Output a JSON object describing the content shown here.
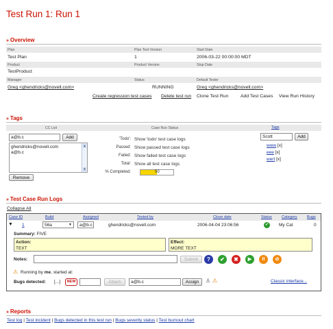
{
  "page_title": "Test Run 1: Run 1",
  "overview": {
    "heading": "Overview",
    "plan_label": "Plan",
    "plan_value": "Test Plan",
    "plan_text_version_label": "Plan Text Version",
    "plan_text_version_value": "1",
    "start_date_label": "Start Date",
    "start_date_value": "2006-03-22 00:00:00 MDT",
    "product_label": "Product",
    "product_value": "TestProduct",
    "product_version_label": "Product Version",
    "stop_date_label": "Stop Date",
    "manager_label": "Manager",
    "manager_value": "Greg <ghendricks@novell.com>",
    "status_label": "Status",
    "status_value": "RUNNING",
    "default_tester_label": "Default Tester",
    "default_tester_value": "Greg <ghendricks@novell.com>",
    "actions": [
      "Create regression test cases",
      "Delete test run",
      "Clone Test Run",
      "Add Test Cases",
      "View Run History"
    ]
  },
  "tags": {
    "heading": "Tags",
    "cc_list_header": "CC List",
    "cc_input_value": "a@b.c",
    "add_label": "Add",
    "cc_items": [
      "ghendricks@novell.com",
      "a@b.c"
    ],
    "remove_label": "Remove",
    "run_status_header": "Case Run Status",
    "status_rows": [
      {
        "label": "'Todo':",
        "link": "Show 'todo' test case logs"
      },
      {
        "label": "Passed:",
        "link": "Show passed test case logs"
      },
      {
        "label": "Failed:",
        "link": "Show failed test case logs"
      },
      {
        "label": "Total:",
        "link": "Show all test case logs"
      }
    ],
    "completed_label": "% Completed:",
    "completed_percent": 50,
    "completed_text": "50",
    "tags_header": "Tags",
    "tag_input_value": "Scott",
    "tag_add_label": "Add",
    "tag_items": [
      {
        "name": "www",
        "remove": "[x]"
      },
      {
        "name": "eee",
        "remove": "[x]"
      },
      {
        "name": "wert",
        "remove": "[x]"
      }
    ]
  },
  "logs": {
    "heading": "Test Case Run Logs",
    "collapse_all": "Collapse All",
    "columns": [
      "Case ID",
      "Build",
      "Assigned",
      "Tested by",
      "Close date",
      "Status",
      "Category",
      "Bugs"
    ],
    "row": {
      "expander": "▼",
      "case_id": "1",
      "build": "56a",
      "assigned": "a@b.c",
      "tested_by": "ghendricks@novell.com",
      "close_date": "2006-04-04 23:06:56",
      "category": "My Cat",
      "bugs": "0"
    },
    "summary_label": "Summary:",
    "summary_value": "FIVE",
    "action_label": "Action:",
    "action_value": "TEXT",
    "effect_label": "Effect:",
    "effect_value": "MORE TEXT",
    "notes_label": "Notes:",
    "submit_label": "Submit",
    "running_by_prefix": "Running by",
    "running_by_user": "me",
    "running_by_suffix": ", started at:",
    "bugs_detected_label": "Bugs detected:",
    "bugs_ellipsis": "[...]",
    "new_badge": "NEW",
    "attach_label": "Attach",
    "assign_input_value": "a@b.c",
    "assign_label": "Assign",
    "classic_link": "Classic interface..."
  },
  "reports": {
    "heading": "Reports",
    "links": [
      "Test log",
      "Test incident",
      "Bugs detected in this test run",
      "Bugs severity status",
      "Test burnout chart"
    ],
    "separator": "|"
  },
  "colors": {
    "accent_red": "#cc1100",
    "link_blue": "#1a3aa8",
    "progress_yellow": "#f5d600",
    "note_yellow": "#ffffcc"
  }
}
